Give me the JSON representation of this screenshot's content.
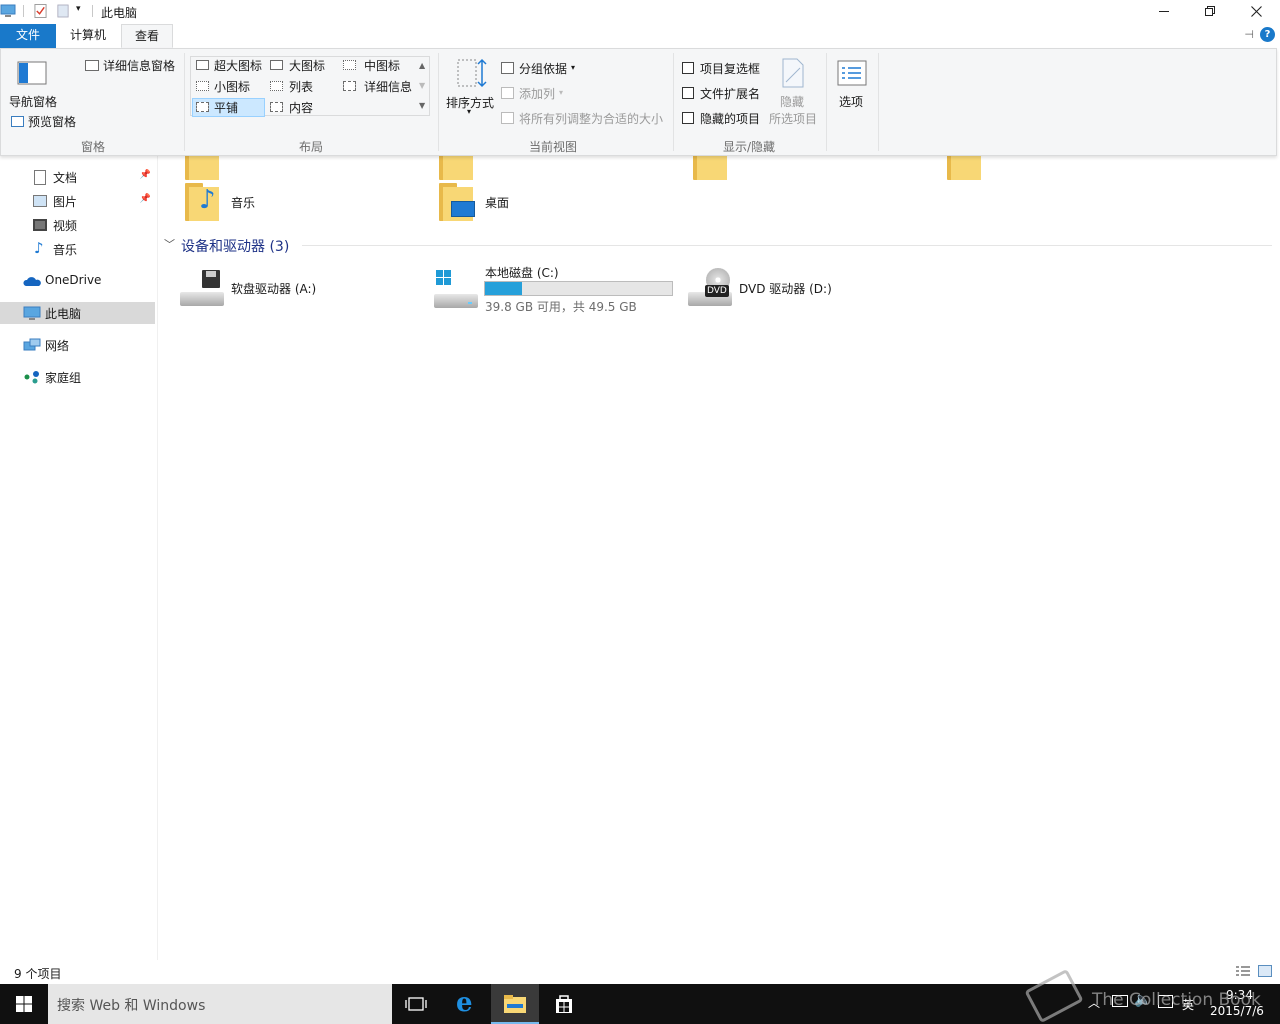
{
  "window": {
    "title": "此电脑"
  },
  "tabs": {
    "file": "文件",
    "computer": "计算机",
    "view": "查看"
  },
  "ribbon": {
    "panes": {
      "nav_pane": "导航窗格",
      "preview_pane": "预览窗格",
      "details_pane": "详细信息窗格",
      "group_label": "窗格"
    },
    "layout": {
      "extra_large": "超大图标",
      "large": "大图标",
      "medium": "中图标",
      "small": "小图标",
      "list": "列表",
      "details": "详细信息",
      "tiles": "平铺",
      "content": "内容",
      "group_label": "布局"
    },
    "current_view": {
      "sort_by": "排序方式",
      "group_by": "分组依据",
      "add_column": "添加列",
      "size_all_columns": "将所有列调整为合适的大小",
      "group_label": "当前视图"
    },
    "show_hide": {
      "item_checkboxes": "项目复选框",
      "file_extensions": "文件扩展名",
      "hidden_items": "隐藏的项目",
      "hide_selected_line1": "隐藏",
      "hide_selected_line2": "所选项目",
      "group_label": "显示/隐藏"
    },
    "options": "选项"
  },
  "nav": {
    "items": [
      {
        "label": "文档",
        "pinned": true
      },
      {
        "label": "图片",
        "pinned": true
      },
      {
        "label": "视频",
        "pinned": false
      },
      {
        "label": "音乐",
        "pinned": false
      },
      {
        "label": "OneDrive"
      },
      {
        "label": "此电脑",
        "selected": true
      },
      {
        "label": "网络"
      },
      {
        "label": "家庭组"
      }
    ]
  },
  "content": {
    "folders": [
      {
        "label": "音乐"
      },
      {
        "label": "桌面"
      }
    ],
    "devices_header": "设备和驱动器 (3)",
    "drives": [
      {
        "label": "软盘驱动器 (A:)"
      },
      {
        "label": "本地磁盘 (C:)",
        "free_space": "39.8 GB 可用，共 49.5 GB",
        "used_fraction": 0.196
      },
      {
        "label": "DVD 驱动器 (D:)",
        "badge": "DVD"
      }
    ]
  },
  "status": {
    "item_count": "9 个项目"
  },
  "taskbar": {
    "search_placeholder": "搜索 Web 和 Windows",
    "ime": "英",
    "time": "9:34",
    "date": "2015/7/6"
  },
  "watermark": "The Collection Book",
  "colors": {
    "accent": "#1979ca",
    "section_header": "#1e3287",
    "selection": "#cce8ff",
    "capacity_fill": "#26a0da",
    "taskbar": "#101010"
  }
}
